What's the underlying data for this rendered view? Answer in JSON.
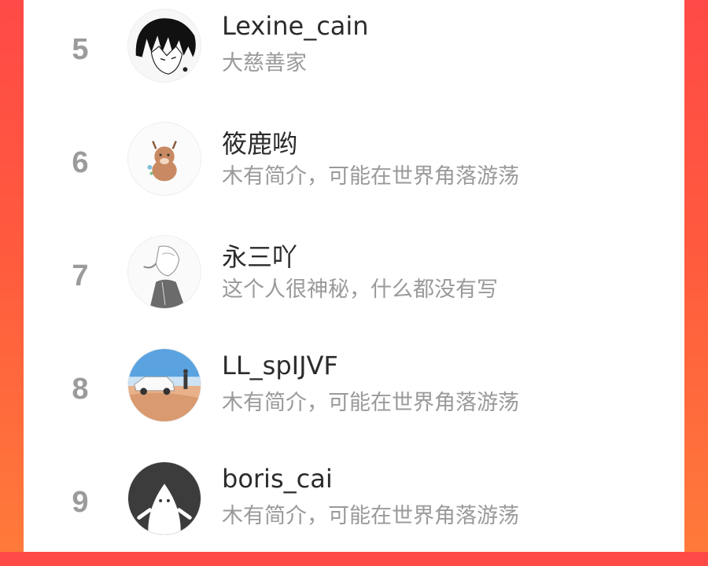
{
  "users": [
    {
      "rank": "5",
      "name": "Lexine_cain",
      "bio": "大慈善家",
      "avatar_icon": "anime-character-avatar"
    },
    {
      "rank": "6",
      "name": "筱鹿哟",
      "bio": "木有简介，可能在世界角落游荡",
      "avatar_icon": "deer-cartoon-avatar"
    },
    {
      "rank": "7",
      "name": "永三吖",
      "bio": "这个人很神秘，什么都没有写",
      "avatar_icon": "sketch-character-avatar"
    },
    {
      "rank": "8",
      "name": "LL_spIJVF",
      "bio": "木有简介，可能在世界角落游荡",
      "avatar_icon": "desert-suv-photo-avatar"
    },
    {
      "rank": "9",
      "name": "boris_cai",
      "bio": "木有简介，可能在世界角落游荡",
      "avatar_icon": "default-ghost-avatar"
    }
  ],
  "colors": {
    "accent_gradient_top": "#ff4a47",
    "accent_gradient_bottom": "#ff7a3a",
    "rank_gray": "#9b9b9b",
    "name_dark": "#2b2b2b",
    "bio_gray": "#9a9a9a"
  }
}
